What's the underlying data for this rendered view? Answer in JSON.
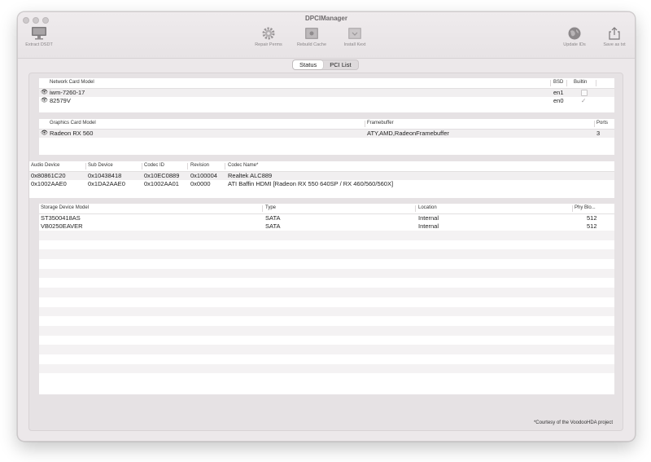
{
  "window": {
    "title": "DPCIManager"
  },
  "toolbar": {
    "extract_dsdt": "Extract DSDT",
    "repair_perms": "Repair Perms",
    "rebuild_cache": "Rebuild Cache",
    "install_kext": "Install Kext",
    "update_ids": "Update IDs",
    "save_as_txt": "Save as txt"
  },
  "tabs": {
    "status": "Status",
    "pci_list": "PCI List",
    "selected": "Status"
  },
  "network": {
    "headers": {
      "model": "Network Card Model",
      "bsd": "BSD",
      "builtin": "Builtin"
    },
    "rows": [
      {
        "model": "iwm-7260-17",
        "bsd": "en1",
        "builtin": false
      },
      {
        "model": "82579V",
        "bsd": "en0",
        "builtin": true
      }
    ]
  },
  "graphics": {
    "headers": {
      "model": "Graphics Card Model",
      "framebuffer": "Framebuffer",
      "ports": "Ports"
    },
    "rows": [
      {
        "model": "Radeon RX 560",
        "framebuffer": "ATY,AMD,RadeonFramebuffer",
        "ports": "3"
      }
    ]
  },
  "audio": {
    "headers": {
      "device": "Audio Device",
      "sub": "Sub Device",
      "codec_id": "Codec ID",
      "revision": "Revision",
      "codec_name": "Codec Name*"
    },
    "rows": [
      {
        "device": "0x80861C20",
        "sub": "0x10438418",
        "codec_id": "0x10EC0889",
        "revision": "0x100004",
        "codec_name": "Realtek ALC889"
      },
      {
        "device": "0x1002AAE0",
        "sub": "0x1DA2AAE0",
        "codec_id": "0x1002AA01",
        "revision": "0x0000",
        "codec_name": "ATI Baffin HDMI [Radeon RX 550 640SP / RX 460/560/560X]"
      }
    ]
  },
  "storage": {
    "headers": {
      "model": "Storage Device Model",
      "type": "Type",
      "location": "Location",
      "phy": "Phy Blo..."
    },
    "rows": [
      {
        "model": "ST3500418AS",
        "type": "SATA",
        "location": "Internal",
        "phy": "512"
      },
      {
        "model": "VB0250EAVER",
        "type": "SATA",
        "location": "Internal",
        "phy": "512"
      }
    ]
  },
  "footer": {
    "courtesy": "*Courtesy of the VoodooHDA project"
  }
}
